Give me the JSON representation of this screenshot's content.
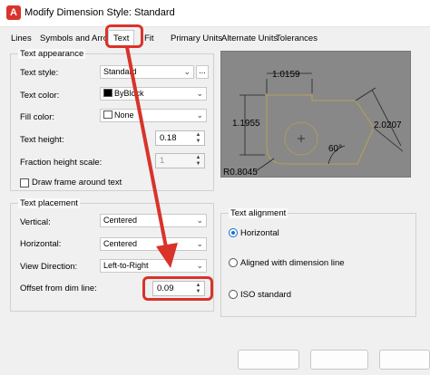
{
  "window": {
    "title": "Modify Dimension Style: Standard",
    "app_icon_letter": "A"
  },
  "tabs": [
    {
      "label": "Lines"
    },
    {
      "label": "Symbols and Arrows"
    },
    {
      "label": "Text",
      "active": true
    },
    {
      "label": "Fit"
    },
    {
      "label": "Primary Units"
    },
    {
      "label": "Alternate Units"
    },
    {
      "label": "Tolerances"
    }
  ],
  "text_appearance": {
    "title": "Text appearance",
    "text_style": {
      "label": "Text style:",
      "value": "Standard",
      "more_button": "..."
    },
    "text_color": {
      "label": "Text color:",
      "value": "ByBlock",
      "swatch": "#000000"
    },
    "fill_color": {
      "label": "Fill color:",
      "value": "None",
      "swatch": "#ffffff"
    },
    "text_height": {
      "label": "Text height:",
      "value": "0.18"
    },
    "fraction_height_scale": {
      "label": "Fraction height scale:",
      "value": "1"
    },
    "draw_frame": {
      "label": "Draw frame around text",
      "checked": false
    }
  },
  "text_placement": {
    "title": "Text placement",
    "vertical": {
      "label": "Vertical:",
      "value": "Centered"
    },
    "horizontal": {
      "label": "Horizontal:",
      "value": "Centered"
    },
    "view_direction": {
      "label": "View Direction:",
      "value": "Left-to-Right"
    },
    "offset": {
      "label": "Offset from dim line:",
      "value": "0.09"
    }
  },
  "text_alignment": {
    "title": "Text alignment",
    "options": [
      {
        "label": "Horizontal",
        "checked": true
      },
      {
        "label": "Aligned with dimension line",
        "checked": false
      },
      {
        "label": "ISO standard",
        "checked": false
      }
    ]
  },
  "preview": {
    "dim_top": "1.0159",
    "dim_left": "1.1955",
    "dim_right": "2.0207",
    "angle": "60°",
    "radius": "R0.8045"
  },
  "colors": {
    "highlight": "#d9332a",
    "preview_bg": "#888888",
    "accent": "#1a6fd0"
  }
}
